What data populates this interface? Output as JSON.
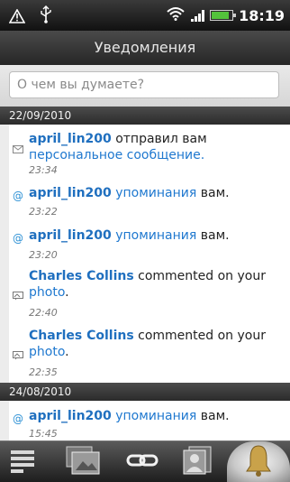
{
  "status_bar": {
    "time": "18:19",
    "left_icons": [
      "warning-icon",
      "usb-icon"
    ],
    "right_icons": [
      "wifi-icon",
      "signal-icon",
      "battery-icon"
    ]
  },
  "header": {
    "title": "Уведомления"
  },
  "status_input": {
    "placeholder": "О чем вы думаете?"
  },
  "sections": [
    {
      "date": "22/09/2010",
      "items": [
        {
          "icon": "envelope-icon",
          "user": "april_lin200",
          "before": " отправил вам ",
          "link": "персональное сообщение.",
          "after": "",
          "time": "23:34"
        },
        {
          "icon": "at-icon",
          "user": "april_lin200",
          "before": " ",
          "link": "упоминания",
          "after": " вам.",
          "time": "23:22"
        },
        {
          "icon": "at-icon",
          "user": "april_lin200",
          "before": " ",
          "link": "упоминания",
          "after": " вам.",
          "time": "23:20"
        },
        {
          "icon": "photo-comment-icon",
          "user": "Charles Collins",
          "before": " commented on your ",
          "link": "photo",
          "after": ".",
          "time": "22:40"
        },
        {
          "icon": "photo-comment-icon",
          "user": "Charles Collins",
          "before": " commented on your ",
          "link": "photo",
          "after": ".",
          "time": "22:35"
        }
      ]
    },
    {
      "date": "24/08/2010",
      "items": [
        {
          "icon": "at-icon",
          "user": "april_lin200",
          "before": " ",
          "link": "упоминания",
          "after": " вам.",
          "time": "15:45"
        }
      ]
    }
  ],
  "bottom_tabs": [
    {
      "name": "news-feed-tab-icon",
      "active": false
    },
    {
      "name": "photos-tab-icon",
      "active": false
    },
    {
      "name": "links-tab-icon",
      "active": false
    },
    {
      "name": "contacts-tab-icon",
      "active": false
    },
    {
      "name": "notifications-bell-tab-icon",
      "active": true
    }
  ],
  "colors": {
    "link": "#1f78cf",
    "user": "#1f6fbf",
    "accent_green": "#53c23b"
  },
  "battery_level": 0.85
}
